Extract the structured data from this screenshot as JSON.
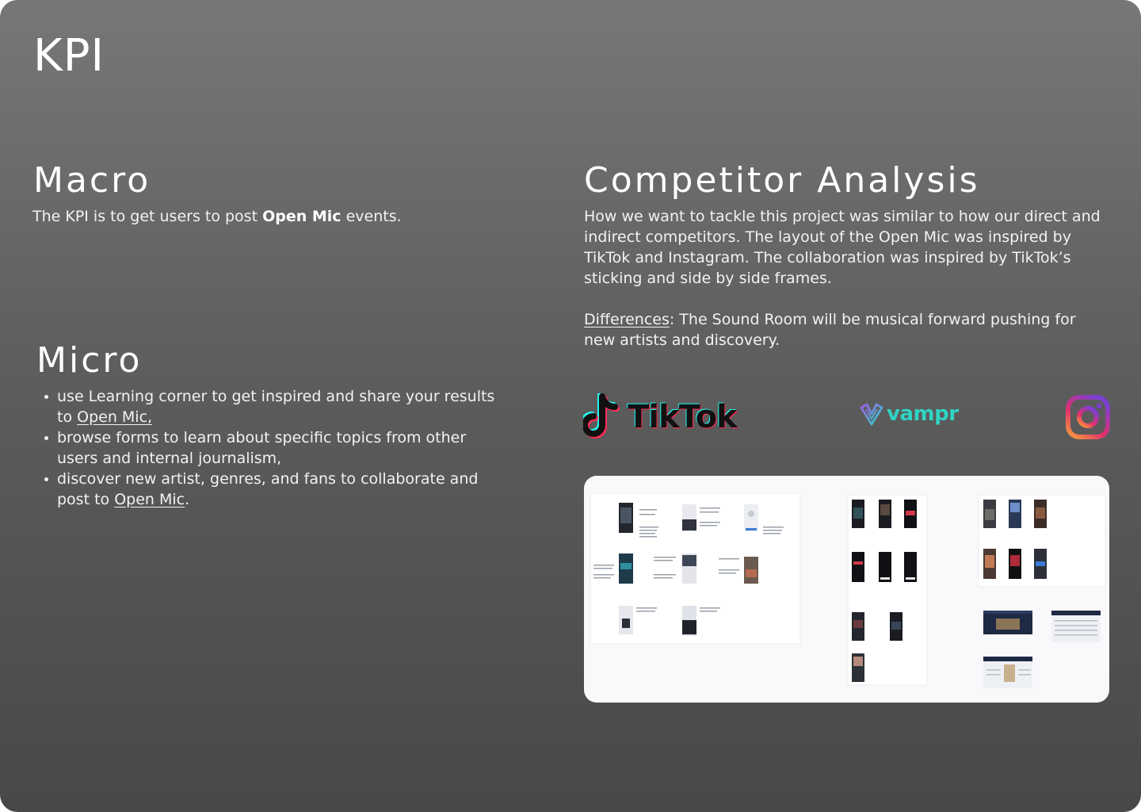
{
  "page": {
    "title": "KPI"
  },
  "macro": {
    "heading": "Macro",
    "text_before": "The KPI is to get users to post ",
    "text_bold": "Open Mic",
    "text_after": " events."
  },
  "micro": {
    "heading": "Micro",
    "items": [
      {
        "text": "use Learning corner to get inspired and share your results to ",
        "link": "Open Mic,",
        "after": ""
      },
      {
        "text": "browse forms to learn about specific topics from other users and internal journalism,",
        "link": "",
        "after": ""
      },
      {
        "text": "discover new artist, genres, and fans to collaborate and post to ",
        "link": "Open Mic",
        "after": "."
      }
    ]
  },
  "competitor": {
    "heading": "Competitor Analysis",
    "paragraph": "How we want to tackle this project was similar to how our direct and indirect competitors. The layout of the Open Mic was inspired by TikTok and Instagram. The collaboration was inspired by TikTok’s sticking and side by side frames.",
    "differences_label": "Differences",
    "differences_text": ": The Sound Room will be musical forward pushing for new artists and discovery."
  },
  "logos": {
    "tiktok": {
      "label": "TikTok",
      "icon": "tiktok-note-icon"
    },
    "vampr": {
      "label": "vampr",
      "icon": "vampr-v-icon"
    },
    "instagram": {
      "icon": "instagram-camera-icon"
    }
  },
  "colors": {
    "bg_top": "#777777",
    "bg_bottom": "#484848",
    "text": "#ffffff",
    "tiktok_cyan": "#25f4ee",
    "tiktok_red": "#ff2b54",
    "vampr_teal": "#2fd3c2",
    "board_bg": "#f9f9fb"
  }
}
